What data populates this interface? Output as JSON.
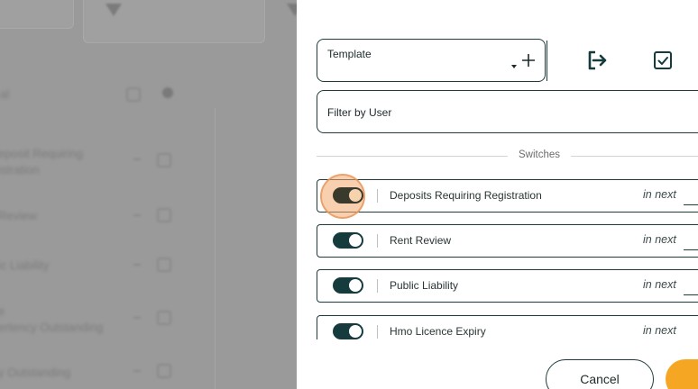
{
  "background": {
    "items": [
      "eposit Requiring",
      "istration",
      "Review",
      "ic Liability",
      "e",
      "ertency Outstanding",
      "y Outstanding"
    ],
    "title_fragment": "al"
  },
  "drawer": {
    "template": {
      "label": "Template"
    },
    "filter": {
      "label": "Filter by User"
    },
    "switches_title": "Switches",
    "switches": [
      {
        "label": "Deposits Requiring Registration",
        "next": "in next",
        "on": true,
        "focused": true
      },
      {
        "label": "Rent Review",
        "next": "in next",
        "on": true,
        "focused": false
      },
      {
        "label": "Public Liability",
        "next": "in next",
        "on": true,
        "focused": false
      },
      {
        "label": "Hmo Licence Expiry",
        "next": "in next",
        "on": true,
        "focused": false
      }
    ],
    "buttons": {
      "cancel": "Cancel"
    }
  },
  "colors": {
    "accent": "#163b3d",
    "orange": "#f5a623",
    "focus": "#f4aa6e"
  }
}
